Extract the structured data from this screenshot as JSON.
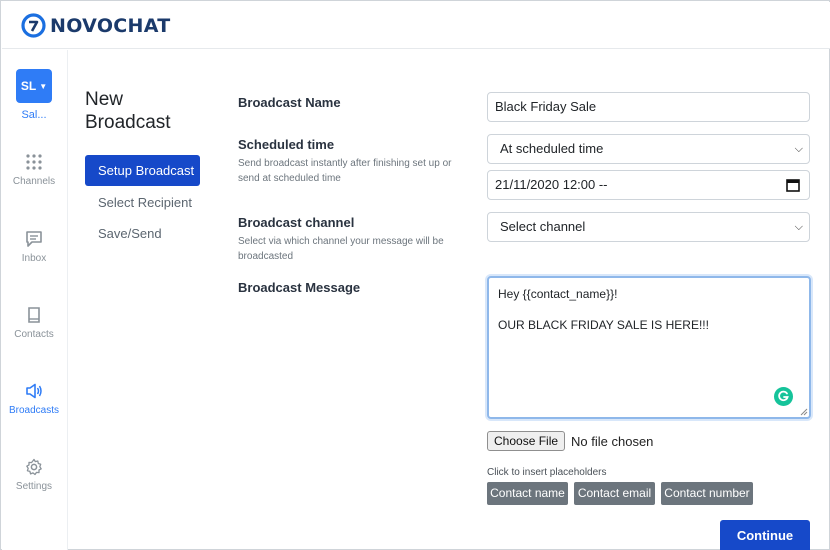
{
  "app": {
    "brand": "NOVOCHAT",
    "brand_color": "#1b3a6b",
    "accent_color": "#1649c9"
  },
  "sidebar": {
    "workspace": {
      "initials": "SL",
      "label": "Sal..."
    },
    "items": [
      {
        "label": "Channels",
        "icon": "grid-dots-icon",
        "active": false
      },
      {
        "label": "Inbox",
        "icon": "chat-bubble-icon",
        "active": false
      },
      {
        "label": "Contacts",
        "icon": "book-icon",
        "active": false
      },
      {
        "label": "Broadcasts",
        "icon": "megaphone-icon",
        "active": true
      },
      {
        "label": "Settings",
        "icon": "gear-icon",
        "active": false
      }
    ]
  },
  "page": {
    "title_line1": "New",
    "title_line2": "Broadcast"
  },
  "steps": [
    {
      "label": "Setup Broadcast",
      "active": true
    },
    {
      "label": "Select Recipient",
      "active": false
    },
    {
      "label": "Save/Send",
      "active": false
    }
  ],
  "form": {
    "name": {
      "label": "Broadcast Name",
      "value": "Black Friday Sale"
    },
    "schedule": {
      "label": "Scheduled time",
      "help": "Send broadcast instantly after finishing set up or send at scheduled time",
      "selected": "At scheduled time",
      "datetime": "21/11/2020 12:00 --"
    },
    "channel": {
      "label": "Broadcast channel",
      "help": "Select via which channel your message will be broadcasted",
      "selected": "Select channel"
    },
    "message": {
      "label": "Broadcast Message",
      "line1": "Hey {{contact_name}}!",
      "line2": "OUR BLACK FRIDAY SALE IS HERE!!!"
    },
    "file": {
      "button": "Choose File",
      "status": "No file chosen"
    },
    "placeholders": {
      "hint": "Click to insert placeholders",
      "buttons": [
        "Contact name",
        "Contact email",
        "Contact number"
      ]
    }
  },
  "actions": {
    "continue": "Continue"
  }
}
